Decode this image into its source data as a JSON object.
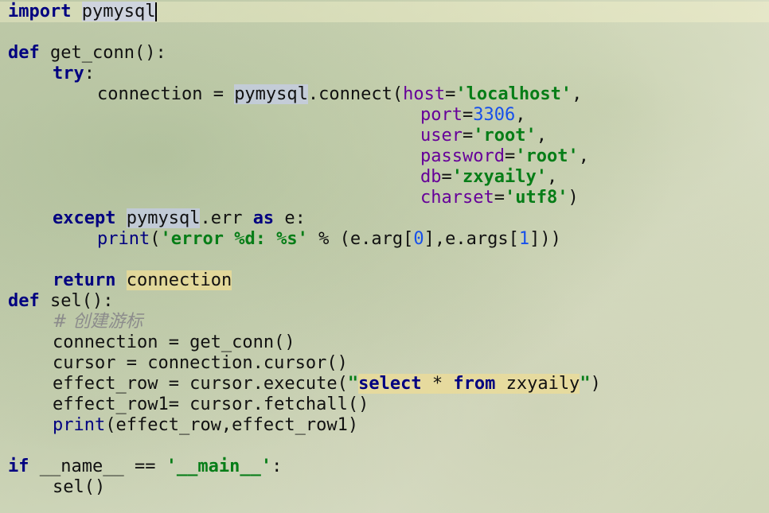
{
  "editor": {
    "lines": {
      "l1": {
        "kw": "import",
        "mod": "pymysql"
      },
      "l2": {
        "kw": "def",
        "name": "get_conn():"
      },
      "l3": {
        "kw": "try",
        "colon": ":"
      },
      "l4": {
        "pre": "connection = ",
        "mod": "pymysql",
        "call": ".connect(",
        "p1": "host",
        "eq": "=",
        "v1": "'localhost'",
        "comma": ","
      },
      "l5": {
        "p": "port",
        "eq": "=",
        "v": "3306",
        "comma": ","
      },
      "l6": {
        "p": "user",
        "eq": "=",
        "v": "'root'",
        "comma": ","
      },
      "l7": {
        "p": "password",
        "eq": "=",
        "v": "'root'",
        "comma": ","
      },
      "l8": {
        "p": "db",
        "eq": "=",
        "v": "'zxyaily'",
        "comma": ","
      },
      "l9": {
        "p": "charset",
        "eq": "=",
        "v": "'utf8'",
        "close": ")"
      },
      "l10": {
        "kw": "except",
        "mod": "pymysql",
        "mid": ".err ",
        "kw2": "as",
        "rest": " e:"
      },
      "l11": {
        "fn": "print",
        "open": "(",
        "s": "'error %d: %s'",
        "mid": " % (e.arg[",
        "n0": "0",
        "mid2": "],e.args[",
        "n1": "1",
        "close": "]))"
      },
      "l12": {
        "kw": "return",
        "sp": " ",
        "var": "connection"
      },
      "l13": {
        "kw": "def",
        "name": " sel():"
      },
      "l14": {
        "cmt": "# 创建游标"
      },
      "l15": {
        "text": "connection = get_conn()"
      },
      "l16": {
        "text": "cursor = connection.cursor()"
      },
      "l17": {
        "pre": "effect_row = cursor.execute(",
        "q1": "\"",
        "sel": "select",
        "star": " * ",
        "from": "from",
        "tbl": " zxyaily",
        "q2": "\"",
        "close": ")"
      },
      "l18": {
        "text": "effect_row1= cursor.fetchall()"
      },
      "l19": {
        "fn": "print",
        "rest": "(effect_row,effect_row1)"
      },
      "l20": {
        "kw": "if",
        "mid": " __name__ == ",
        "s": "'__main__'",
        "colon": ":"
      },
      "l21": {
        "text": "sel()"
      }
    }
  }
}
